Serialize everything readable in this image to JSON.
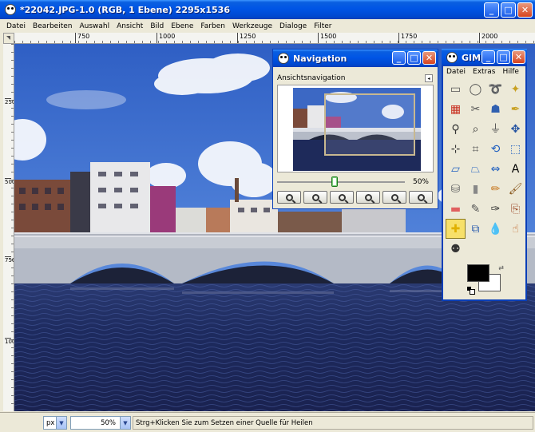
{
  "main_window": {
    "title": "*22042.JPG-1.0 (RGB, 1 Ebene) 2295x1536",
    "menu": [
      "Datei",
      "Bearbeiten",
      "Auswahl",
      "Ansicht",
      "Bild",
      "Ebene",
      "Farben",
      "Werkzeuge",
      "Dialoge",
      "Filter"
    ]
  },
  "rulers": {
    "horizontal_ticks": [
      "750",
      "1000",
      "1250",
      "1500",
      "1750",
      "2000"
    ],
    "vertical_ticks": [
      "250",
      "500",
      "750",
      "1000"
    ]
  },
  "statusbar": {
    "unit": "px",
    "zoom": "50%",
    "message": "Strg+Klicken Sie zum Setzen einer Quelle für Heilen"
  },
  "navigation_window": {
    "title": "Navigation",
    "label": "Ansichtsnavigation",
    "zoom_value": "50%",
    "zoom_fraction": 0.45,
    "buttons": [
      "zoom-out",
      "zoom-in",
      "zoom-1-1",
      "zoom-fit",
      "zoom-fill",
      "shrink-wrap"
    ]
  },
  "toolbox_window": {
    "title": "GIMP",
    "menu": [
      "Datei",
      "Extras",
      "Hilfe"
    ],
    "tools": [
      {
        "name": "rect-select-icon",
        "glyph": "▭",
        "color": "#555555"
      },
      {
        "name": "ellipse-select-icon",
        "glyph": "◯",
        "color": "#555555"
      },
      {
        "name": "free-select-icon",
        "glyph": "➰",
        "color": "#555555"
      },
      {
        "name": "fuzzy-select-icon",
        "glyph": "✦",
        "color": "#c8a020"
      },
      {
        "name": "select-by-color-icon",
        "glyph": "▦",
        "color": "#c83020"
      },
      {
        "name": "scissors-icon",
        "glyph": "✂",
        "color": "#555555"
      },
      {
        "name": "foreground-select-icon",
        "glyph": "☗",
        "color": "#3060b0"
      },
      {
        "name": "paths-icon",
        "glyph": "✒",
        "color": "#c8a020"
      },
      {
        "name": "color-picker-icon",
        "glyph": "⚲",
        "color": "#333333"
      },
      {
        "name": "magnify-icon",
        "glyph": "⌕",
        "color": "#333333"
      },
      {
        "name": "measure-icon",
        "glyph": "⏚",
        "color": "#555555"
      },
      {
        "name": "move-icon",
        "glyph": "✥",
        "color": "#2050a0"
      },
      {
        "name": "align-icon",
        "glyph": "⊹",
        "color": "#333333"
      },
      {
        "name": "crop-icon",
        "glyph": "⌗",
        "color": "#555555"
      },
      {
        "name": "rotate-icon",
        "glyph": "⟲",
        "color": "#2060c0"
      },
      {
        "name": "scale-icon",
        "glyph": "⬚",
        "color": "#2060c0"
      },
      {
        "name": "shear-icon",
        "glyph": "▱",
        "color": "#2060c0"
      },
      {
        "name": "perspective-icon",
        "glyph": "⏢",
        "color": "#2060c0"
      },
      {
        "name": "flip-icon",
        "glyph": "⇔",
        "color": "#2060c0"
      },
      {
        "name": "text-icon",
        "glyph": "A",
        "color": "#000000"
      },
      {
        "name": "bucket-fill-icon",
        "glyph": "⛁",
        "color": "#666666"
      },
      {
        "name": "blend-icon",
        "glyph": "▮",
        "color": "#888888"
      },
      {
        "name": "pencil-icon",
        "glyph": "✏",
        "color": "#c87820"
      },
      {
        "name": "paintbrush-icon",
        "glyph": "🖌",
        "color": "#8a5a20"
      },
      {
        "name": "eraser-icon",
        "glyph": "▬",
        "color": "#e06060"
      },
      {
        "name": "airbrush-icon",
        "glyph": "✎",
        "color": "#555555"
      },
      {
        "name": "ink-icon",
        "glyph": "✑",
        "color": "#333333"
      },
      {
        "name": "clone-icon",
        "glyph": "⎘",
        "color": "#a05030"
      },
      {
        "name": "heal-icon",
        "glyph": "✚",
        "color": "#e0b000",
        "active": true
      },
      {
        "name": "perspective-clone-icon",
        "glyph": "⧉",
        "color": "#3060b0"
      },
      {
        "name": "blur-icon",
        "glyph": "💧",
        "color": "#3070c0"
      },
      {
        "name": "smudge-icon",
        "glyph": "☝",
        "color": "#c06020"
      },
      {
        "name": "dodge-burn-icon",
        "glyph": "⚉",
        "color": "#333333"
      }
    ],
    "foreground_color": "#000000",
    "background_color": "#ffffff"
  }
}
